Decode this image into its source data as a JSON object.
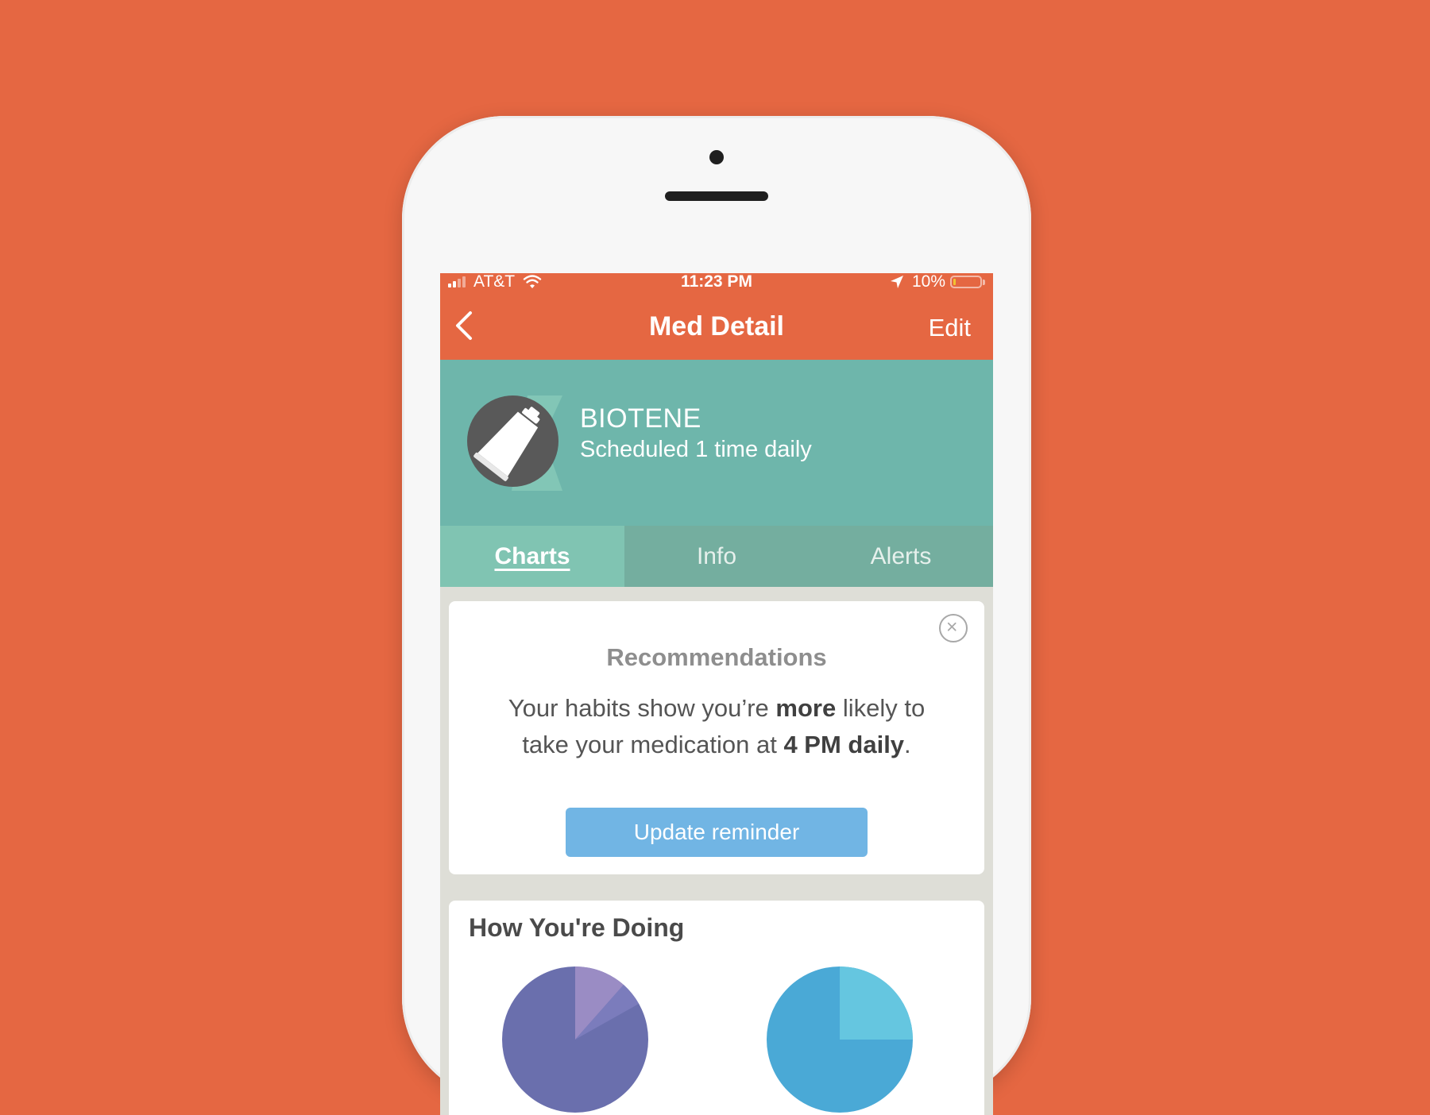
{
  "status_bar": {
    "carrier": "AT&T",
    "time": "11:23 PM",
    "battery_percent": "10%",
    "battery_level": 0.1,
    "signal_bars": 2,
    "signal_bars_total": 4
  },
  "nav": {
    "back_icon": "chevron-left-icon",
    "title": "Med Detail",
    "edit_label": "Edit"
  },
  "medication": {
    "name": "BIOTENE",
    "schedule": "Scheduled 1 time daily",
    "icon": "tube-icon"
  },
  "tabs": [
    {
      "label": "Charts",
      "active": true
    },
    {
      "label": "Info",
      "active": false
    },
    {
      "label": "Alerts",
      "active": false
    }
  ],
  "recommendations": {
    "title": "Recommendations",
    "text_part1": "Your habits show you’re ",
    "text_bold1": "more",
    "text_part2": " likely to take your medication at ",
    "text_bold2": "4 PM daily",
    "text_part3": ".",
    "button_label": "Update reminder",
    "close_icon": "close-circle-icon"
  },
  "how_youre_doing": {
    "title": "How You're Doing"
  },
  "colors": {
    "brand_orange": "#e56742",
    "header_teal": "#6eb6ab",
    "active_tab": "#80c4b2",
    "button_blue": "#71b5e4",
    "pie1": [
      "#6a6fad",
      "#9a8cc4",
      "#7b7cbc"
    ],
    "pie2": [
      "#4aa9d6",
      "#65c6e0"
    ]
  }
}
